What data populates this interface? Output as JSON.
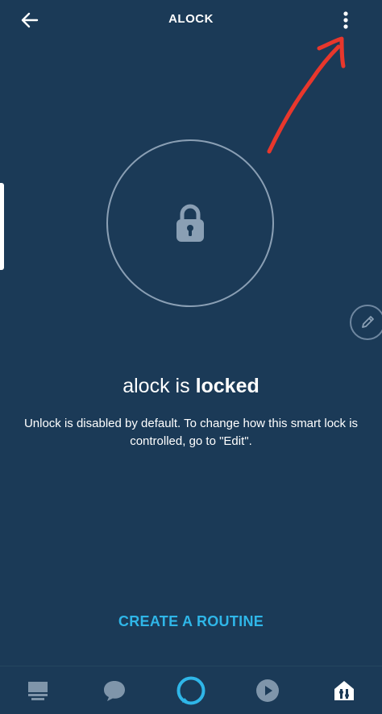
{
  "header": {
    "title": "ALOCK",
    "back_icon": "arrow-left-icon",
    "menu_icon": "more-vertical-icon"
  },
  "device": {
    "name": "alock",
    "connector": "is",
    "state": "locked",
    "lock_icon": "padlock-icon"
  },
  "description": "Unlock is disabled by default. To change how this smart lock is controlled, go to \"Edit\".",
  "edit": {
    "icon": "pencil-icon"
  },
  "routine": {
    "label": "CREATE A ROUTINE"
  },
  "bottom_nav": {
    "items": [
      {
        "icon": "home-icon"
      },
      {
        "icon": "communicate-icon"
      },
      {
        "icon": "alexa-icon"
      },
      {
        "icon": "play-icon"
      },
      {
        "icon": "devices-icon"
      }
    ]
  },
  "colors": {
    "background": "#1b3a57",
    "accent": "#2fb6e8",
    "annotation": "#e8372c",
    "muted_icon": "#8a9fb4"
  }
}
